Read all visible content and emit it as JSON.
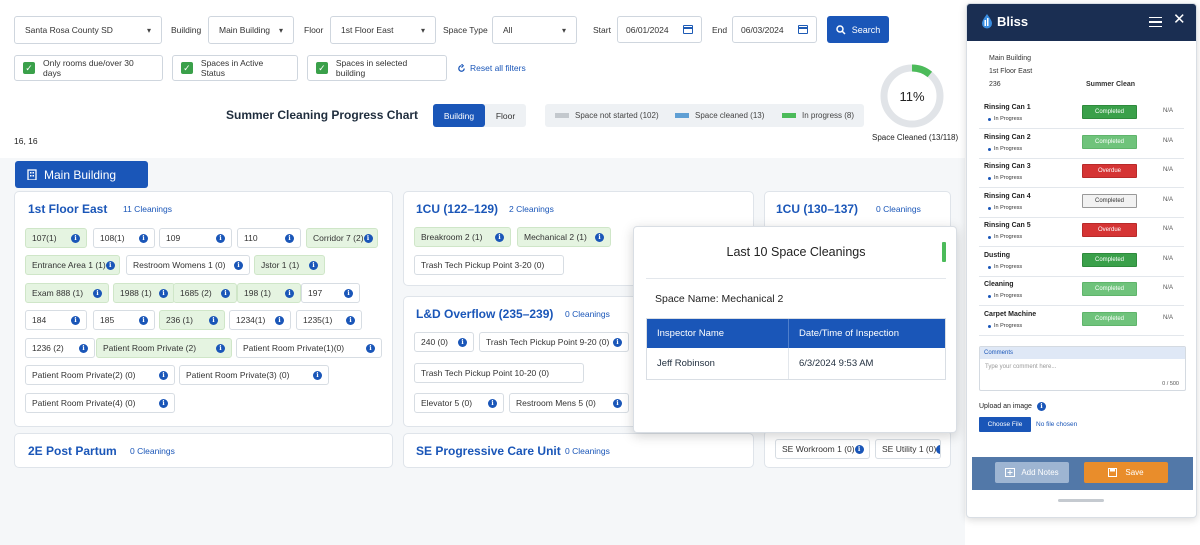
{
  "filters": {
    "district": "Santa Rosa County SD",
    "building_label": "Building",
    "building": "Main Building",
    "floor_label": "Floor",
    "floor": "1st Floor East",
    "space_type_label": "Space Type",
    "space_type": "All",
    "start_label": "Start",
    "start": "06/01/2024",
    "end_label": "End",
    "end": "06/03/2024",
    "search": "Search",
    "chk1": "Only rooms due/over 30 days",
    "chk2": "Spaces in Active Status",
    "chk3": "Spaces in selected building",
    "reset": "Reset all filters"
  },
  "chart": {
    "title": "Summer Cleaning Progress Chart",
    "tab_building": "Building",
    "tab_floor": "Floor",
    "legend_not_started": "Space not started (102)",
    "legend_cleaned": "Space cleaned (13)",
    "legend_in_progress": "In progress (8)",
    "percent": "11%",
    "progress_fraction": 0.11,
    "caption": "Space Cleaned (13/118)",
    "colors": {
      "not_started": "#c3c8cd",
      "cleaned": "#5f9fd4",
      "in_progress": "#4cbb5a"
    }
  },
  "coords": "16, 16",
  "building_header": "Main Building",
  "cards": {
    "c1": {
      "title": "1st Floor East",
      "count": "11 Cleanings",
      "chips": [
        "107(1)",
        "108(1)",
        "109",
        "110",
        "Corridor 7 (2)",
        "Entrance Area 1 (1)",
        "Restroom Womens 1 (0)",
        "Jstor 1 (1)",
        "Exam 888 (1)",
        "1988 (1)",
        "1685 (2)",
        "198 (1)",
        "197",
        "184",
        "185",
        "236 (1)",
        "1234(1)",
        "1235(1)",
        "1236 (2)",
        "Patient Room Private (2)",
        "Patient Room Private(1)(0)",
        "Patient Room Private(2) (0)",
        "Patient Room Private(3) (0)",
        "Patient Room Private(4) (0)"
      ]
    },
    "c2": {
      "title": "1CU (122–129)",
      "count": "2 Cleanings",
      "chips": [
        "Breakroom 2 (1)",
        "Mechanical 2 (1)",
        "Trash Tech Pickup Point 3-20 (0)"
      ]
    },
    "c3": {
      "title": "1CU (130–137)",
      "count": "0 Cleanings"
    },
    "c4": {
      "title": "L&D Overflow (235–239)",
      "count": "0 Cleanings",
      "chips": [
        "240 (0)",
        "Trash Tech Pickup Point 9-20 (0)",
        "Trash Tech Pickup Point 10-20 (0)",
        "Elevator 5 (0)",
        "Restroom Mens 5 (0)"
      ]
    },
    "c5": {
      "title": "2E Post Partum",
      "count": "0 Cleanings"
    },
    "c6": {
      "title": "SE Progressive Care Unit",
      "count": "0 Cleanings"
    },
    "c7": {
      "chips": [
        "SE Workroom 1 (0)",
        "SE Utility 1 (0)"
      ]
    }
  },
  "popup": {
    "title": "Last 10 Space Cleanings",
    "space_name": "Space Name: Mechanical 2",
    "col1": "Inspector Name",
    "col2": "Date/Time of Inspection",
    "row_name": "Jeff Robinson",
    "row_date": "6/3/2024 9:53 AM"
  },
  "panel": {
    "brand": "Bliss",
    "building": "Main Building",
    "floor": "1st Floor East",
    "room": "236",
    "program": "Summer Clean",
    "tasks": [
      {
        "name": "Rinsing Can 1",
        "status": "In Progress",
        "result": "Completed",
        "style": "done",
        "na": "N/A"
      },
      {
        "name": "Rinsing Can 2",
        "status": "In Progress",
        "result": "Completed",
        "style": "light",
        "na": "N/A"
      },
      {
        "name": "Rinsing Can 3",
        "status": "In Progress",
        "result": "Overdue",
        "style": "overdue",
        "na": "N/A"
      },
      {
        "name": "Rinsing Can 4",
        "status": "In Progress",
        "result": "Completed",
        "style": "outline",
        "na": "N/A"
      },
      {
        "name": "Rinsing Can 5",
        "status": "In Progress",
        "result": "Overdue",
        "style": "overdue",
        "na": "N/A"
      },
      {
        "name": "Dusting",
        "status": "In Progress",
        "result": "Completed",
        "style": "done",
        "na": "N/A"
      },
      {
        "name": "Cleaning",
        "status": "In Progress",
        "result": "Completed",
        "style": "light",
        "na": "N/A"
      },
      {
        "name": "Carpet Machine",
        "status": "In Progress",
        "result": "Completed",
        "style": "light",
        "na": "N/A"
      }
    ],
    "comments_label": "Comments",
    "comments_placeholder": "Type your comment here...",
    "counter": "0 / 500",
    "upload_label": "Upload an image",
    "choose_file": "Choose File",
    "no_file": "No file chosen",
    "add_notes": "Add Notes",
    "save": "Save"
  }
}
